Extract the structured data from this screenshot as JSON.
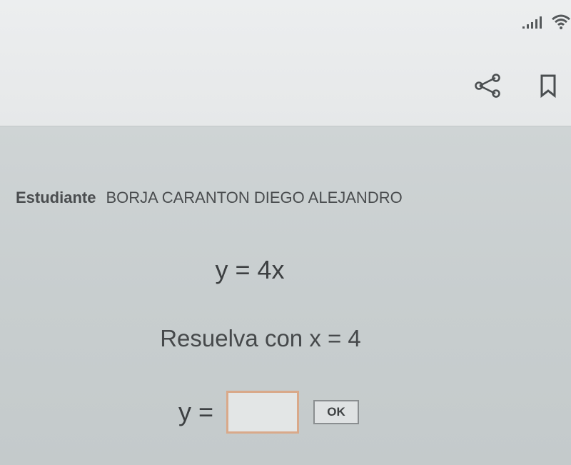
{
  "app": {
    "colors": {
      "header_bg": "#eceeef",
      "content_bg": "#c9cfd0",
      "text": "#3d4042",
      "input_border": "#d9a98a"
    }
  },
  "status_bar": {
    "icons": [
      "signal-icon",
      "wifi-icon"
    ]
  },
  "header": {
    "icons": [
      "share-icon",
      "bookmark-icon"
    ]
  },
  "student": {
    "label": "Estudiante",
    "name": "BORJA CARANTON DIEGO ALEJANDRO"
  },
  "problem": {
    "equation": "y = 4x",
    "instruction": "Resuelva con x = 4"
  },
  "answer": {
    "label": "y =",
    "value": "",
    "ok_label": "OK"
  }
}
